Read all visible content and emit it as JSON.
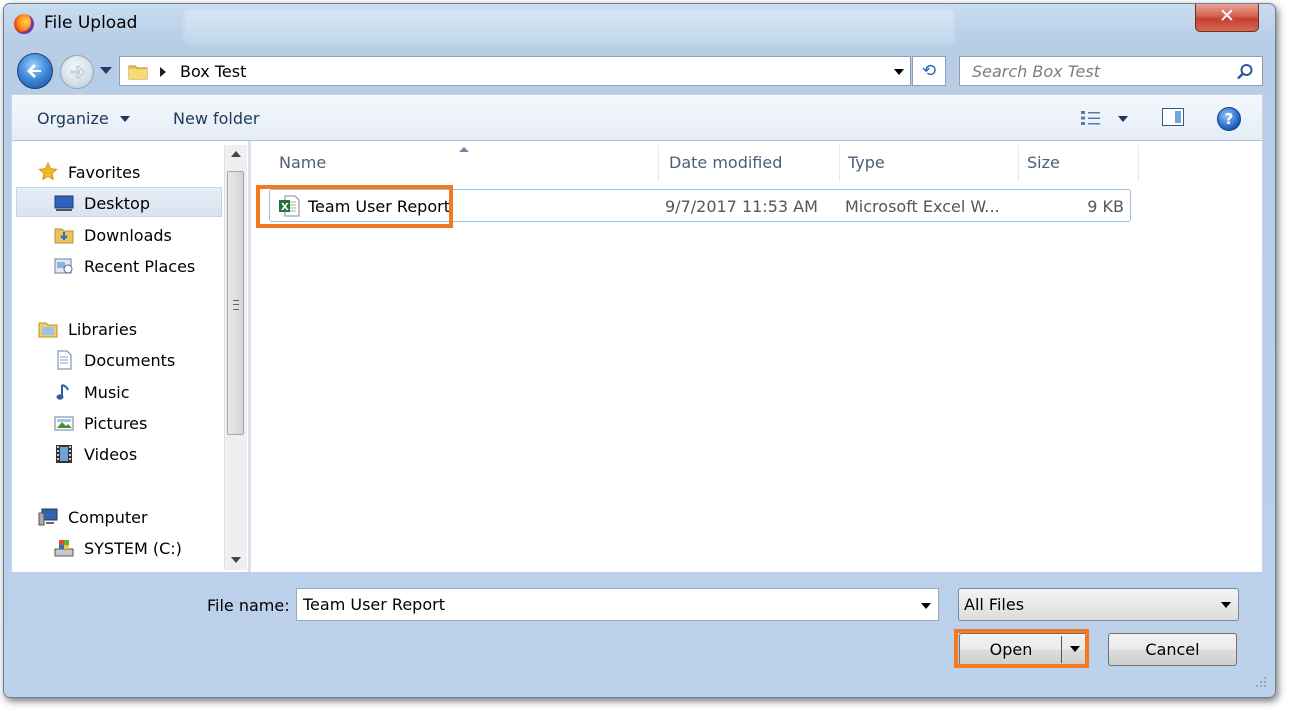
{
  "window": {
    "title": "File Upload",
    "close_glyph": "✕"
  },
  "nav": {
    "breadcrumb": "Box Test",
    "search_placeholder": "Search Box Test"
  },
  "toolbar": {
    "organize": "Organize",
    "new_folder": "New folder"
  },
  "sidebar": {
    "items": [
      {
        "label": "Favorites",
        "icon": "star-icon"
      },
      {
        "label": "Desktop",
        "icon": "desktop-icon",
        "selected": true
      },
      {
        "label": "Downloads",
        "icon": "downloads-folder-icon"
      },
      {
        "label": "Recent Places",
        "icon": "recent-places-icon"
      },
      {
        "label": "Libraries",
        "icon": "libraries-icon"
      },
      {
        "label": "Documents",
        "icon": "documents-icon"
      },
      {
        "label": "Music",
        "icon": "music-note-icon"
      },
      {
        "label": "Pictures",
        "icon": "pictures-icon"
      },
      {
        "label": "Videos",
        "icon": "film-icon"
      },
      {
        "label": "Computer",
        "icon": "computer-icon"
      },
      {
        "label": "SYSTEM (C:)",
        "icon": "drive-icon"
      }
    ]
  },
  "columns": {
    "name": "Name",
    "date": "Date modified",
    "type": "Type",
    "size": "Size"
  },
  "files": [
    {
      "name": "Team User Report",
      "date": "9/7/2017 11:53 AM",
      "type": "Microsoft Excel W...",
      "size": "9 KB",
      "icon": "excel-file-icon"
    }
  ],
  "footer": {
    "file_name_label": "File name:",
    "file_name_value": "Team User Report",
    "filter_value": "All Files",
    "open_label": "Open",
    "cancel_label": "Cancel"
  },
  "colors": {
    "highlight": "#f47a20",
    "accent": "#1a5bb8"
  }
}
